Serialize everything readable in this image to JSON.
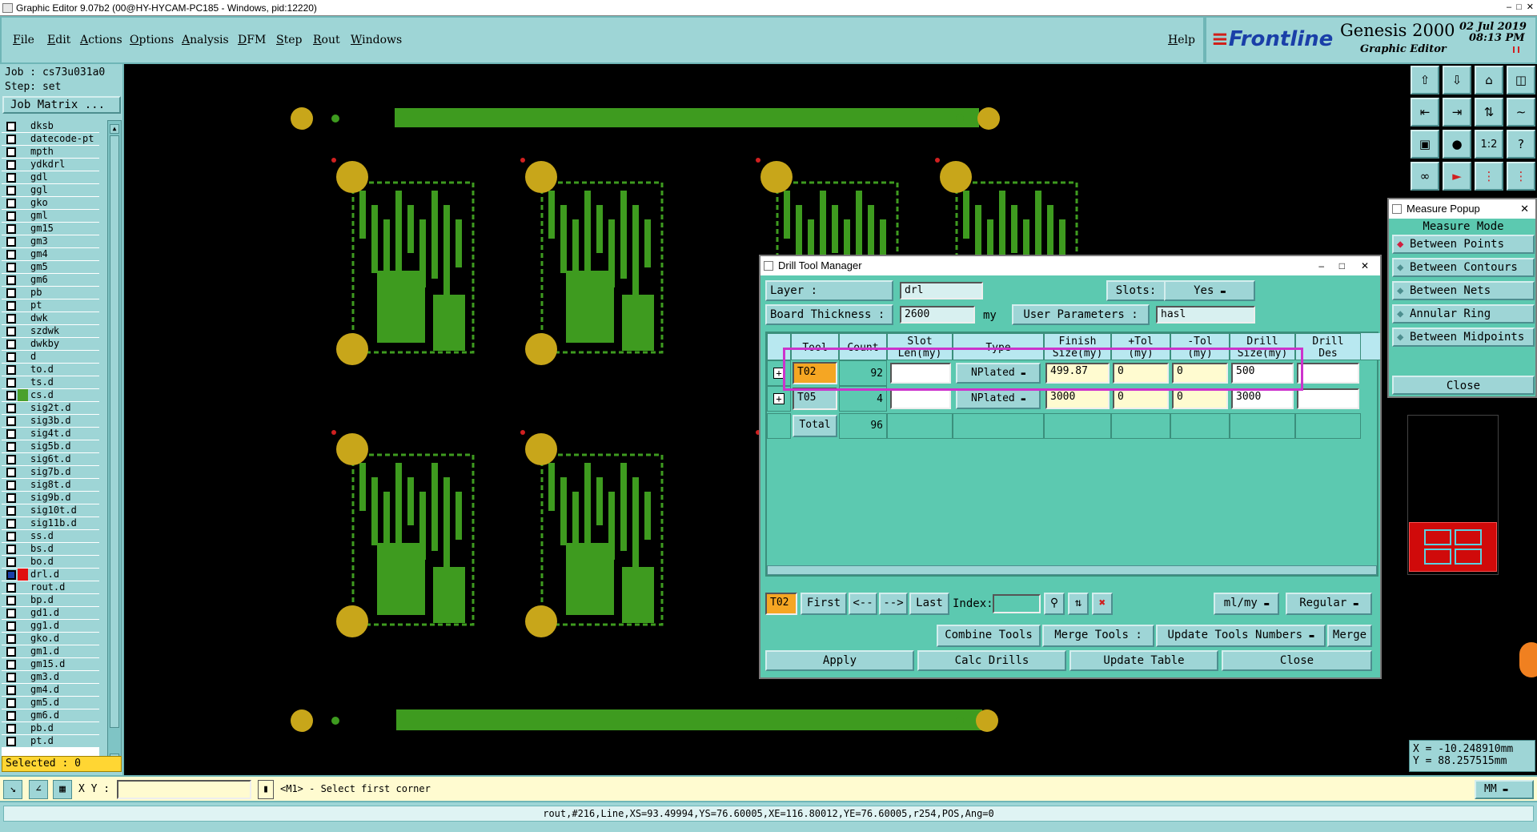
{
  "window": {
    "title": "Graphic Editor 9.07b2 (00@HY-HYCAM-PC185 - Windows, pid:12220)"
  },
  "menu": {
    "items": [
      "File",
      "Edit",
      "Actions",
      "Options",
      "Analysis",
      "DFM",
      "Step",
      "Rout",
      "Windows"
    ],
    "help": "Help"
  },
  "branding": {
    "logo": "Frontline",
    "product": "Genesis 2000",
    "subtitle": "Graphic Editor",
    "date": "02 Jul 2019",
    "time": "08:13 PM"
  },
  "left_panel": {
    "job": "Job : cs73u031a0",
    "step": "Step: set",
    "job_matrix": "Job Matrix ...",
    "selected": "Selected : 0",
    "layers": [
      {
        "name": "dksb",
        "color": "#9ed5d6",
        "active": false
      },
      {
        "name": "datecode-pt",
        "color": "#9ed5d6",
        "active": false
      },
      {
        "name": "mpth",
        "color": "#9ed5d6",
        "active": false
      },
      {
        "name": "ydkdrl",
        "color": "#9ed5d6",
        "active": false
      },
      {
        "name": "gdl",
        "color": "#9ed5d6",
        "active": false
      },
      {
        "name": "ggl",
        "color": "#9ed5d6",
        "active": false
      },
      {
        "name": "gko",
        "color": "#9ed5d6",
        "active": false
      },
      {
        "name": "gml",
        "color": "#9ed5d6",
        "active": false
      },
      {
        "name": "gm15",
        "color": "#9ed5d6",
        "active": false
      },
      {
        "name": "gm3",
        "color": "#9ed5d6",
        "active": false
      },
      {
        "name": "gm4",
        "color": "#9ed5d6",
        "active": false
      },
      {
        "name": "gm5",
        "color": "#9ed5d6",
        "active": false
      },
      {
        "name": "gm6",
        "color": "#9ed5d6",
        "active": false
      },
      {
        "name": "pb",
        "color": "#9ed5d6",
        "active": false
      },
      {
        "name": "pt",
        "color": "#9ed5d6",
        "active": false
      },
      {
        "name": "dwk",
        "color": "#9ed5d6",
        "active": false
      },
      {
        "name": "szdwk",
        "color": "#9ed5d6",
        "active": false
      },
      {
        "name": "dwkby",
        "color": "#9ed5d6",
        "active": false
      },
      {
        "name": "d",
        "color": "#9ed5d6",
        "active": false
      },
      {
        "name": "to.d",
        "color": "#9ed5d6",
        "active": false
      },
      {
        "name": "ts.d",
        "color": "#9ed5d6",
        "active": false
      },
      {
        "name": "cs.d",
        "color": "#4aa02c",
        "active": true
      },
      {
        "name": "sig2t.d",
        "color": "#9ed5d6",
        "active": false
      },
      {
        "name": "sig3b.d",
        "color": "#9ed5d6",
        "active": false
      },
      {
        "name": "sig4t.d",
        "color": "#9ed5d6",
        "active": false
      },
      {
        "name": "sig5b.d",
        "color": "#9ed5d6",
        "active": false
      },
      {
        "name": "sig6t.d",
        "color": "#9ed5d6",
        "active": false
      },
      {
        "name": "sig7b.d",
        "color": "#9ed5d6",
        "active": false
      },
      {
        "name": "sig8t.d",
        "color": "#9ed5d6",
        "active": false
      },
      {
        "name": "sig9b.d",
        "color": "#9ed5d6",
        "active": false
      },
      {
        "name": "sig10t.d",
        "color": "#9ed5d6",
        "active": false
      },
      {
        "name": "sig11b.d",
        "color": "#9ed5d6",
        "active": false
      },
      {
        "name": "ss.d",
        "color": "#9ed5d6",
        "active": false
      },
      {
        "name": "bs.d",
        "color": "#9ed5d6",
        "active": false
      },
      {
        "name": "bo.d",
        "color": "#9ed5d6",
        "active": false
      },
      {
        "name": "drl.d",
        "color": "#e01010",
        "active": true
      },
      {
        "name": "rout.d",
        "color": "#9ed5d6",
        "active": false
      },
      {
        "name": "bp.d",
        "color": "#9ed5d6",
        "active": false
      },
      {
        "name": "gd1.d",
        "color": "#9ed5d6",
        "active": false
      },
      {
        "name": "gg1.d",
        "color": "#9ed5d6",
        "active": false
      },
      {
        "name": "gko.d",
        "color": "#9ed5d6",
        "active": false
      },
      {
        "name": "gm1.d",
        "color": "#9ed5d6",
        "active": false
      },
      {
        "name": "gm15.d",
        "color": "#9ed5d6",
        "active": false
      },
      {
        "name": "gm3.d",
        "color": "#9ed5d6",
        "active": false
      },
      {
        "name": "gm4.d",
        "color": "#9ed5d6",
        "active": false
      },
      {
        "name": "gm5.d",
        "color": "#9ed5d6",
        "active": false
      },
      {
        "name": "gm6.d",
        "color": "#9ed5d6",
        "active": false
      },
      {
        "name": "pb.d",
        "color": "#9ed5d6",
        "active": false
      },
      {
        "name": "pt.d",
        "color": "#9ed5d6",
        "active": false
      }
    ]
  },
  "drill_dialog": {
    "title": "Drill Tool Manager",
    "layer_label": "Layer       :",
    "layer_value": "drl",
    "slots_label": "Slots:",
    "slots_value": "Yes",
    "board_thickness_label": "Board Thickness :",
    "board_thickness_value": "2600",
    "board_thickness_unit": "my",
    "user_params_label": "User Parameters :",
    "user_params_value": "hasl",
    "columns": {
      "tool": "Tool",
      "count": "Count",
      "slot_len": [
        "Slot",
        "Len(my)"
      ],
      "type": "Type",
      "finish": [
        "Finish",
        "Size(my)"
      ],
      "ptol": [
        "+Tol",
        "(my)"
      ],
      "mtol": [
        "-Tol",
        "(my)"
      ],
      "drill": [
        "Drill",
        "Size(my)"
      ],
      "des": [
        "Drill",
        "Des"
      ]
    },
    "rows": [
      {
        "tool": "T02",
        "count": "92",
        "slot_len": "",
        "type": "NPlated",
        "finish": "499.87",
        "ptol": "0",
        "mtol": "0",
        "drill": "500",
        "des": ""
      },
      {
        "tool": "T05",
        "count": "4",
        "slot_len": "",
        "type": "NPlated",
        "finish": "3000",
        "ptol": "0",
        "mtol": "0",
        "drill": "3000",
        "des": ""
      }
    ],
    "total_label": "Total",
    "total_value": "96",
    "current_tool": "T02",
    "nav": {
      "first": "First",
      "prev": "<--",
      "next": "-->",
      "last": "Last",
      "index_label": "Index:",
      "units": "ml/my",
      "mode": "Regular"
    },
    "combine_tools": "Combine Tools",
    "merge_tools_label": "Merge Tools :",
    "update_numbers": "Update Tools Numbers",
    "merge": "Merge",
    "buttons": {
      "apply": "Apply",
      "calc": "Calc Drills",
      "update": "Update Table",
      "close": "Close"
    }
  },
  "measure_popup": {
    "title": "Measure Popup",
    "mode_label": "Measure Mode",
    "modes": [
      "Between Points",
      "Between Contours",
      "Between Nets",
      "Annular Ring",
      "Between Midpoints"
    ],
    "selected_mode": "Between Points",
    "close": "Close"
  },
  "coords": {
    "x": "X = -10.248910mm",
    "y": "Y = 88.257515mm"
  },
  "command_bar": {
    "xy_label": "X Y :",
    "prompt": "<M1> - Select first corner",
    "units": "MM"
  },
  "status_bar": {
    "text": "rout,#216,Line,XS=93.49994,YS=76.60005,XE=116.80012,YE=76.60005,r254,POS,Ang=0"
  },
  "colors": {
    "panel": "#9ed5d6",
    "dialog": "#5cc9b0",
    "pcb_green": "#3e9b1f",
    "pad_gold": "#c8a61a",
    "highlight": "#cc33cc",
    "tool_orange": "#f5a623"
  }
}
